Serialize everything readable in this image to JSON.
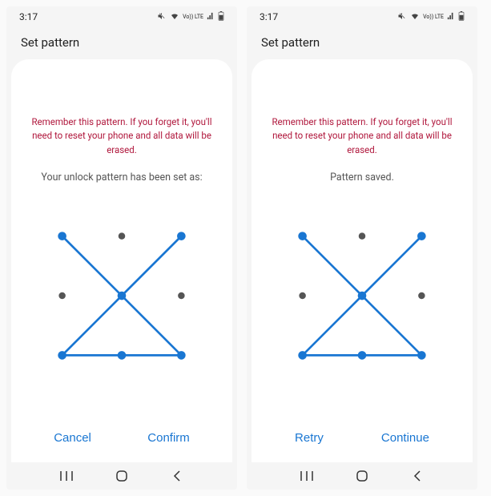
{
  "status": {
    "time": "3:17",
    "lte_label": "Vo)) LTE"
  },
  "header": {
    "title": "Set pattern"
  },
  "warn_text": "Remember this pattern. If you forget it, you'll need to reset your phone and all data will be erased.",
  "screens": [
    {
      "message": "Your unlock pattern has been set as:",
      "left_button": "Cancel",
      "right_button": "Confirm"
    },
    {
      "message": "Pattern saved.",
      "left_button": "Retry",
      "right_button": "Continue"
    }
  ],
  "pattern": {
    "grid": 3,
    "sequence": [
      0,
      8,
      6,
      4,
      2,
      6
    ],
    "active_nodes": [
      0,
      2,
      4,
      6,
      7,
      8
    ],
    "inactive_nodes": [
      1,
      3,
      5
    ]
  },
  "icons": {
    "mute": "mute-icon",
    "wifi": "wifi-icon",
    "signal": "signal-icon",
    "battery": "battery-icon",
    "recents": "recents-icon",
    "home": "home-icon",
    "back": "back-icon"
  },
  "colors": {
    "accent": "#1976d2",
    "warn": "#b0173c"
  }
}
